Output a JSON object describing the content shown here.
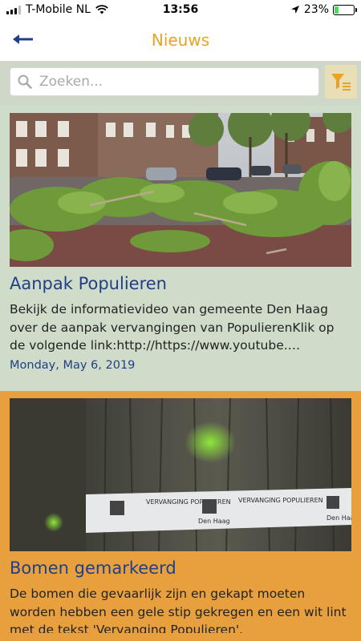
{
  "status_bar": {
    "carrier": "T-Mobile NL",
    "time": "13:56",
    "battery_percent": "23%",
    "battery_level": 0.23,
    "signal_bars_filled": 3,
    "signal_bars_total": 4,
    "icons": [
      "signal-icon",
      "wifi-icon",
      "location-icon",
      "battery-icon"
    ]
  },
  "nav": {
    "title": "Nieuws",
    "back_icon": "arrow-left-icon"
  },
  "search": {
    "placeholder": "Zoeken...",
    "value": "",
    "icon": "search-icon",
    "filter_icon": "filter-icon"
  },
  "news": [
    {
      "title": "Aanpak Populieren",
      "body": "Bekijk de informatievideo van gemeente Den Haag over de aanpak vervangingen van PopulierenKlik op de volgende link:http://https://www.youtube.…",
      "date": "Monday, May 6, 2019",
      "image": "photo-fallen-poplar-trees-street",
      "background": "#cfdcc9"
    },
    {
      "title": "Bomen gemarkeerd",
      "body": "De bomen die gevaarlijk zijn en gekapt moeten worden hebben een gele stip gekregen en een wit lint met de tekst 'Vervanging Populieren'.",
      "image": "photo-marked-tree-trunk-ribbon",
      "ribbon_text": "VERVANGING POPULIEREN",
      "ribbon_logo_text": "Den Haag",
      "background": "#e8a03e"
    }
  ],
  "colors": {
    "accent": "#e8a224",
    "title_blue": "#213f86",
    "card_green": "#cfdcc9",
    "card_orange": "#e8a03e",
    "search_strip": "#cfd8c8",
    "filter_button": "#e9dfb6"
  }
}
